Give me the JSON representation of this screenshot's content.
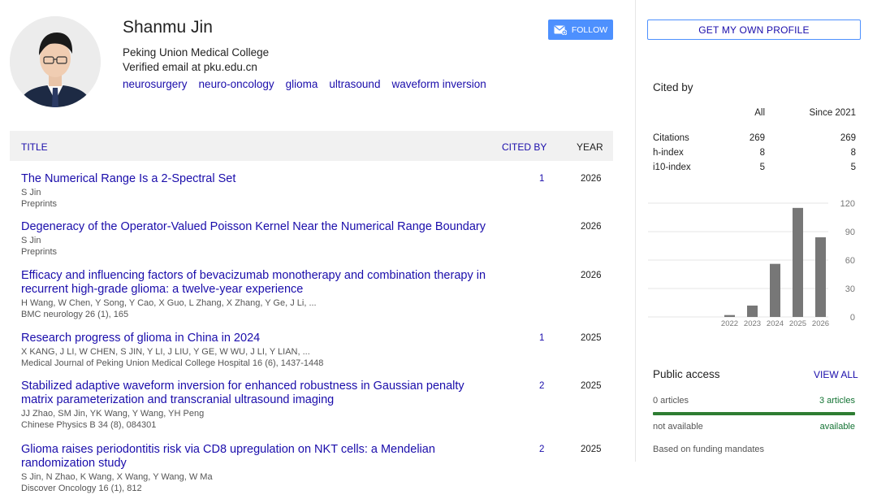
{
  "profile": {
    "name": "Shanmu Jin",
    "affiliation": "Peking Union Medical College",
    "email": "Verified email at pku.edu.cn",
    "interests": [
      "neurosurgery",
      "neuro-oncology",
      "glioma",
      "ultrasound",
      "waveform inversion"
    ]
  },
  "buttons": {
    "follow": "FOLLOW",
    "get_own_profile": "GET MY OWN PROFILE"
  },
  "table": {
    "col_title": "TITLE",
    "col_cited": "CITED BY",
    "col_year": "YEAR"
  },
  "publications": [
    {
      "title": "The Numerical Range Is a 2-Spectral Set",
      "authors": "S Jin",
      "venue": "Preprints",
      "cited_by": "1",
      "year": "2026"
    },
    {
      "title": "Degeneracy of the Operator-Valued Poisson Kernel Near the Numerical Range Boundary",
      "authors": "S Jin",
      "venue": "Preprints",
      "cited_by": "",
      "year": "2026"
    },
    {
      "title": "Efficacy and influencing factors of bevacizumab monotherapy and combination therapy in recurrent high-grade glioma: a twelve-year experience",
      "authors": "H Wang, W Chen, Y Song, Y Cao, X Guo, L Zhang, X Zhang, Y Ge, J Li, ...",
      "venue": "BMC neurology 26 (1), 165",
      "cited_by": "",
      "year": "2026"
    },
    {
      "title": "Research progress of glioma in China in 2024",
      "authors": "X KANG, J LI, W CHEN, S JIN, Y LI, J LIU, Y GE, W WU, J LI, Y LIAN, ...",
      "venue": "Medical Journal of Peking Union Medical College Hospital 16 (6), 1437-1448",
      "cited_by": "1",
      "year": "2025"
    },
    {
      "title": "Stabilized adaptive waveform inversion for enhanced robustness in Gaussian penalty matrix parameterization and transcranial ultrasound imaging",
      "authors": "JJ Zhao, SM Jin, YK Wang, Y Wang, YH Peng",
      "venue": "Chinese Physics B 34 (8), 084301",
      "cited_by": "2",
      "year": "2025"
    },
    {
      "title": "Glioma raises periodontitis risk via CD8 upregulation on NKT cells: a Mendelian randomization study",
      "authors": "S Jin, N Zhao, K Wang, X Wang, Y Wang, W Ma",
      "venue": "Discover Oncology 16 (1), 812",
      "cited_by": "2",
      "year": "2025"
    }
  ],
  "cited_by": {
    "heading": "Cited by",
    "col_all": "All",
    "col_since": "Since 2021",
    "rows": [
      {
        "label": "Citations",
        "all": "269",
        "since": "269"
      },
      {
        "label": "h-index",
        "all": "8",
        "since": "8"
      },
      {
        "label": "i10-index",
        "all": "5",
        "since": "5"
      }
    ]
  },
  "chart_data": {
    "type": "bar",
    "categories": [
      "2022",
      "2023",
      "2024",
      "2025",
      "2026"
    ],
    "values": [
      2,
      12,
      56,
      115,
      84
    ],
    "ylim": [
      0,
      120
    ],
    "yticks": [
      "0",
      "30",
      "60",
      "90",
      "120"
    ],
    "grid": true,
    "bar_color": "#777777"
  },
  "public_access": {
    "heading": "Public access",
    "view_all": "VIEW ALL",
    "not_available_count": "0 articles",
    "available_count": "3 articles",
    "not_available_label": "not available",
    "available_label": "available",
    "available_fraction": 1.0,
    "note": "Based on funding mandates"
  },
  "colors": {
    "link": "#1a0dab",
    "accent": "#4d90fe",
    "green": "#2e7d32"
  }
}
